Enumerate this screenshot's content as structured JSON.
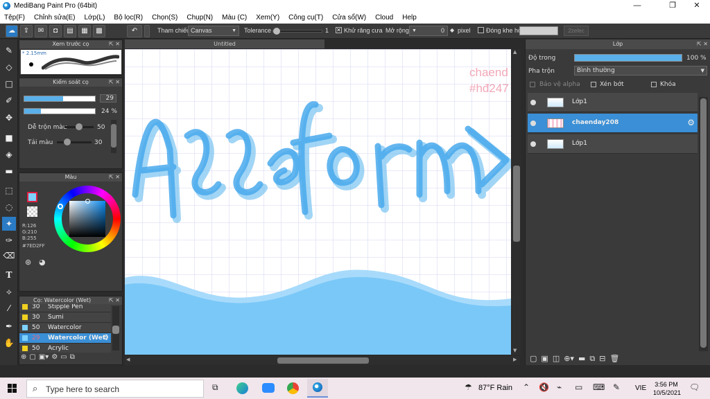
{
  "titlebar": {
    "title": "MediBang Paint Pro (64bit)",
    "minimize": "—",
    "maximize": "❐",
    "close": "✕"
  },
  "menu": [
    "Tệp(F)",
    "Chỉnh sửa(E)",
    "Lớp(L)",
    "Bộ lọc(R)",
    "Chọn(S)",
    "Chụp(N)",
    "Màu (C)",
    "Xem(Y)",
    "Công cụ(T)",
    "Cửa sổ(W)",
    "Cloud",
    "Help"
  ],
  "toolbar": {
    "reference_label": "Tham chiếu",
    "reference_value": "Canvas",
    "tolerance_label": "Tolerance",
    "tolerance_value": "1",
    "antialias_label": "Khử răng cưa",
    "expand_label": "Mở rộng",
    "expand_value": "0",
    "expand_unit": "pixel",
    "close_gap_label": "Đóng khe hở",
    "extra_label": "2zelec"
  },
  "brush_preview": {
    "title": "Xem trước cọ",
    "size": "2.15mm"
  },
  "brush_control": {
    "title": "Kiểm soát cọ",
    "size_value": "29",
    "size_fraction": 0.55,
    "opacity_value": "24 %",
    "opacity_fraction": 0.24,
    "mix_label": "Dễ trộn màu",
    "mix_value": "50",
    "mix_fraction": 0.5,
    "load_label": "Tải màu",
    "load_value": "30",
    "load_fraction": 0.3
  },
  "color_panel": {
    "title": "Màu",
    "r": "R:126",
    "g": "G:210",
    "b": "B:255",
    "hex": "#7ED2FF",
    "fg": "#7ED2FF"
  },
  "brush_list": {
    "title": "Cọ: Watercolor (Wet)",
    "items": [
      {
        "size": "30",
        "name": "Stipple Pen",
        "color": "#f0d020"
      },
      {
        "size": "30",
        "name": "Sumi",
        "color": "#f0d020"
      },
      {
        "size": "50",
        "name": "Watercolor",
        "color": "#7ed2ff"
      },
      {
        "size": "29",
        "name": "Watercolor (Wet)",
        "color": "#7ed2ff",
        "selected": true
      },
      {
        "size": "50",
        "name": "Acrylic",
        "color": "#f0d020"
      }
    ]
  },
  "document": {
    "tab": "Untitled",
    "watermark_line1": "chaend",
    "watermark_line2": "#hđ247",
    "artwork_text": "Aceforon >"
  },
  "layers": {
    "title": "Lớp",
    "opacity_label": "Độ trong",
    "opacity_value": "100 %",
    "blend_label": "Pha trộn",
    "blend_value": "Bình thường",
    "protect_alpha": "Bảo vệ alpha",
    "clipping": "Xén bớt",
    "lock": "Khóa",
    "rows": [
      {
        "name": "Lớp1",
        "selected": false
      },
      {
        "name": "chaenday208",
        "selected": true
      },
      {
        "name": "Lớp1",
        "selected": false
      }
    ]
  },
  "taskbar": {
    "search_placeholder": "Type here to search",
    "weather": "87°F  Rain",
    "lang": "VIE",
    "time": "3:56 PM",
    "date": "10/5/2021"
  }
}
